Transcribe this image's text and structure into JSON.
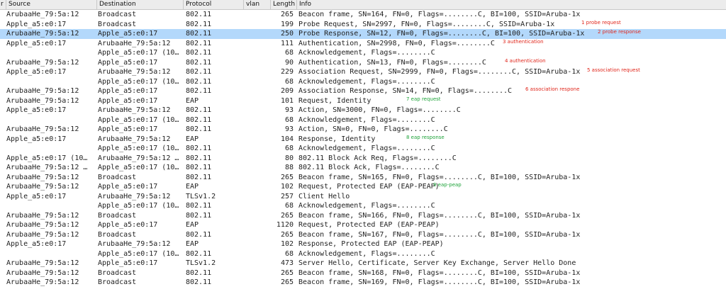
{
  "columns": {
    "col0": "r",
    "source": "Source",
    "destination": "Destination",
    "protocol": "Protocol",
    "vlan": "vlan",
    "length": "Length",
    "info": "Info"
  },
  "colors": {
    "selected_row": "#b3d8fb",
    "annotation_red": "#e0261b",
    "annotation_green": "#1fa33a"
  },
  "packets": [
    {
      "source": "ArubaaHe_79:5a:12",
      "destination": "Broadcast",
      "protocol": "802.11",
      "length": "265",
      "info": "Beacon frame, SN=164, FN=0, Flags=........C, BI=100, SSID=Aruba-1x"
    },
    {
      "source": "Apple_a5:e0:17",
      "destination": "Broadcast",
      "protocol": "802.11",
      "length": "199",
      "info": "Probe Request, SN=2997, FN=0, Flags=........C, SSID=Aruba-1x"
    },
    {
      "source": "ArubaaHe_79:5a:12",
      "destination": "Apple_a5:e0:17",
      "protocol": "802.11",
      "length": "250",
      "info": "Probe Response, SN=12, FN=0, Flags=........C, BI=100, SSID=Aruba-1x",
      "selected": true
    },
    {
      "source": "Apple_a5:e0:17",
      "destination": "ArubaaHe_79:5a:12",
      "protocol": "802.11",
      "length": "111",
      "info": "Authentication, SN=2998, FN=0, Flags=........C"
    },
    {
      "source": "",
      "destination": "Apple_a5:e0:17 (10…",
      "protocol": "802.11",
      "length": "68",
      "info": "Acknowledgement, Flags=........C"
    },
    {
      "source": "ArubaaHe_79:5a:12",
      "destination": "Apple_a5:e0:17",
      "protocol": "802.11",
      "length": "90",
      "info": "Authentication, SN=13, FN=0, Flags=........C"
    },
    {
      "source": "Apple_a5:e0:17",
      "destination": "ArubaaHe_79:5a:12",
      "protocol": "802.11",
      "length": "229",
      "info": "Association Request, SN=2999, FN=0, Flags=........C, SSID=Aruba-1x"
    },
    {
      "source": "",
      "destination": "Apple_a5:e0:17 (10…",
      "protocol": "802.11",
      "length": "68",
      "info": "Acknowledgement, Flags=........C"
    },
    {
      "source": "ArubaaHe_79:5a:12",
      "destination": "Apple_a5:e0:17",
      "protocol": "802.11",
      "length": "209",
      "info": "Association Response, SN=14, FN=0, Flags=........C"
    },
    {
      "source": "ArubaaHe_79:5a:12",
      "destination": "Apple_a5:e0:17",
      "protocol": "EAP",
      "length": "101",
      "info": "Request, Identity"
    },
    {
      "source": "Apple_a5:e0:17",
      "destination": "ArubaaHe_79:5a:12",
      "protocol": "802.11",
      "length": "93",
      "info": "Action, SN=3000, FN=0, Flags=........C"
    },
    {
      "source": "",
      "destination": "Apple_a5:e0:17 (10…",
      "protocol": "802.11",
      "length": "68",
      "info": "Acknowledgement, Flags=........C"
    },
    {
      "source": "ArubaaHe_79:5a:12",
      "destination": "Apple_a5:e0:17",
      "protocol": "802.11",
      "length": "93",
      "info": "Action, SN=0, FN=0, Flags=........C"
    },
    {
      "source": "Apple_a5:e0:17",
      "destination": "ArubaaHe_79:5a:12",
      "protocol": "EAP",
      "length": "104",
      "info": "Response, Identity"
    },
    {
      "source": "",
      "destination": "Apple_a5:e0:17 (10…",
      "protocol": "802.11",
      "length": "68",
      "info": "Acknowledgement, Flags=........C"
    },
    {
      "source": "Apple_a5:e0:17 (10…",
      "destination": "ArubaaHe_79:5a:12 …",
      "protocol": "802.11",
      "length": "80",
      "info": "802.11 Block Ack Req, Flags=........C"
    },
    {
      "source": "ArubaaHe_79:5a:12 …",
      "destination": "Apple_a5:e0:17 (10…",
      "protocol": "802.11",
      "length": "88",
      "info": "802.11 Block Ack, Flags=........C"
    },
    {
      "source": "ArubaaHe_79:5a:12",
      "destination": "Broadcast",
      "protocol": "802.11",
      "length": "265",
      "info": "Beacon frame, SN=165, FN=0, Flags=........C, BI=100, SSID=Aruba-1x"
    },
    {
      "source": "ArubaaHe_79:5a:12",
      "destination": "Apple_a5:e0:17",
      "protocol": "EAP",
      "length": "102",
      "info": "Request, Protected EAP (EAP-PEAP)"
    },
    {
      "source": "Apple_a5:e0:17",
      "destination": "ArubaaHe_79:5a:12",
      "protocol": "TLSv1.2",
      "length": "257",
      "info": "Client Hello"
    },
    {
      "source": "",
      "destination": "Apple_a5:e0:17 (10…",
      "protocol": "802.11",
      "length": "68",
      "info": "Acknowledgement, Flags=........C"
    },
    {
      "source": "ArubaaHe_79:5a:12",
      "destination": "Broadcast",
      "protocol": "802.11",
      "length": "265",
      "info": "Beacon frame, SN=166, FN=0, Flags=........C, BI=100, SSID=Aruba-1x"
    },
    {
      "source": "ArubaaHe_79:5a:12",
      "destination": "Apple_a5:e0:17",
      "protocol": "EAP",
      "length": "1120",
      "info": "Request, Protected EAP (EAP-PEAP)"
    },
    {
      "source": "ArubaaHe_79:5a:12",
      "destination": "Broadcast",
      "protocol": "802.11",
      "length": "265",
      "info": "Beacon frame, SN=167, FN=0, Flags=........C, BI=100, SSID=Aruba-1x"
    },
    {
      "source": "Apple_a5:e0:17",
      "destination": "ArubaaHe_79:5a:12",
      "protocol": "EAP",
      "length": "102",
      "info": "Response, Protected EAP (EAP-PEAP)"
    },
    {
      "source": "",
      "destination": "Apple_a5:e0:17 (10…",
      "protocol": "802.11",
      "length": "68",
      "info": "Acknowledgement, Flags=........C"
    },
    {
      "source": "ArubaaHe_79:5a:12",
      "destination": "Apple_a5:e0:17",
      "protocol": "TLSv1.2",
      "length": "473",
      "info": "Server Hello, Certificate, Server Key Exchange, Server Hello Done"
    },
    {
      "source": "ArubaaHe_79:5a:12",
      "destination": "Broadcast",
      "protocol": "802.11",
      "length": "265",
      "info": "Beacon frame, SN=168, FN=0, Flags=........C, BI=100, SSID=Aruba-1x"
    },
    {
      "source": "ArubaaHe_79:5a:12",
      "destination": "Broadcast",
      "protocol": "802.11",
      "length": "265",
      "info": "Beacon frame, SN=169, FN=0, Flags=........C, BI=100, SSID=Aruba-1x"
    }
  ],
  "annotations": [
    {
      "row": 1,
      "text": "1 probe request",
      "color": "red"
    },
    {
      "row": 2,
      "text": "2 probe response",
      "color": "red"
    },
    {
      "row": 3,
      "text": "3 authentication",
      "color": "red"
    },
    {
      "row": 5,
      "text": "4 authentication",
      "color": "red"
    },
    {
      "row": 6,
      "text": "5 association request",
      "color": "red"
    },
    {
      "row": 8,
      "text": "6 association respone",
      "color": "red"
    },
    {
      "row": 9,
      "text": "7  eap request",
      "color": "green"
    },
    {
      "row": 13,
      "text": "8 eap response",
      "color": "green"
    },
    {
      "row": 18,
      "text": "9 eap-peap",
      "color": "green"
    }
  ]
}
